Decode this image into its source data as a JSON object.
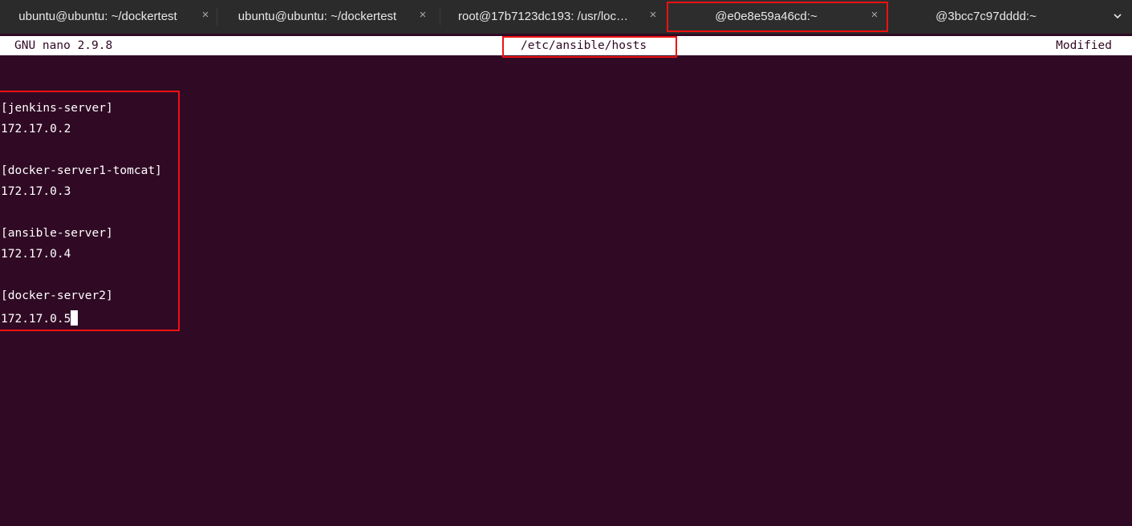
{
  "tabs": [
    {
      "label": "ubuntu@ubuntu: ~/dockertest",
      "close": "×"
    },
    {
      "label": "ubuntu@ubuntu: ~/dockertest",
      "close": "×"
    },
    {
      "label": "root@17b7123dc193: /usr/loc…",
      "close": "×"
    },
    {
      "label": "@e0e8e59a46cd:~",
      "close": "×"
    },
    {
      "label": "@3bcc7c97dddd:~",
      "close": ""
    }
  ],
  "active_tab_index": 3,
  "nano": {
    "version": "GNU nano 2.9.8",
    "filename": "/etc/ansible/hosts",
    "status": "Modified"
  },
  "file_lines": [
    "",
    "[jenkins-server]",
    "172.17.0.2",
    "",
    "[docker-server1-tomcat]",
    "172.17.0.3",
    "",
    "[ansible-server]",
    "172.17.0.4",
    "",
    "[docker-server2]",
    "172.17.0.5"
  ],
  "colors": {
    "terminal_bg": "#300a24",
    "tabbar_bg": "#2b2b2b",
    "highlight": "#ee1111"
  }
}
